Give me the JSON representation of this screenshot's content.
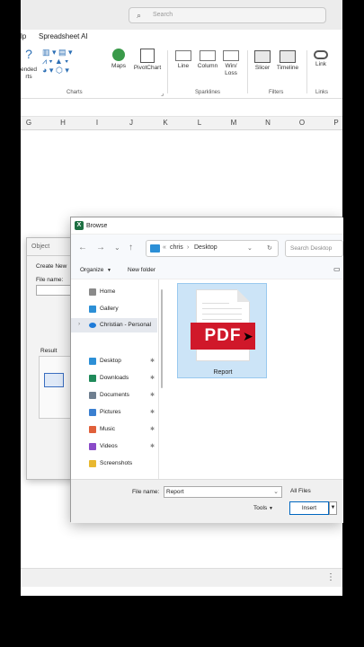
{
  "search": {
    "placeholder": "Search"
  },
  "menu": {
    "help": "lp",
    "spreadsheet_ai": "Spreadsheet AI"
  },
  "ribbon": {
    "recommended": "ended",
    "recommended2": "rts",
    "maps": "Maps",
    "pivotchart": "PivotChart",
    "line": "Line",
    "column": "Column",
    "winloss": "Win/",
    "winloss2": "Loss",
    "slicer": "Slicer",
    "timeline": "Timeline",
    "link": "Link",
    "group_charts": "Charts",
    "group_sparklines": "Sparklines",
    "group_filters": "Filters",
    "group_links": "Links"
  },
  "columns": [
    "G",
    "H",
    "I",
    "J",
    "K",
    "L",
    "M",
    "N",
    "O",
    "P"
  ],
  "object_dialog": {
    "title": "Object",
    "create_new": "Create New",
    "file_name": "File name:",
    "result": "Result"
  },
  "browse": {
    "title": "Browse",
    "address": {
      "root": "chris",
      "folder": "Desktop"
    },
    "search_placeholder": "Search Desktop",
    "organize": "Organize",
    "new_folder": "New folder",
    "nav": [
      {
        "label": "Home"
      },
      {
        "label": "Gallery"
      },
      {
        "label": "Christian - Personal"
      },
      {
        "label": "Desktop"
      },
      {
        "label": "Downloads"
      },
      {
        "label": "Documents"
      },
      {
        "label": "Pictures"
      },
      {
        "label": "Music"
      },
      {
        "label": "Videos"
      },
      {
        "label": "Screenshots"
      }
    ],
    "file": {
      "name": "Report",
      "badge": "PDF"
    },
    "file_name_label": "File name:",
    "file_name_value": "Report",
    "filter": "All Files",
    "tools": "Tools",
    "insert": "Insert"
  },
  "colors": {
    "excel_green": "#1d6f42",
    "pdf_red": "#d0182a",
    "selection": "#cce4f7",
    "accent": "#0067c0"
  }
}
